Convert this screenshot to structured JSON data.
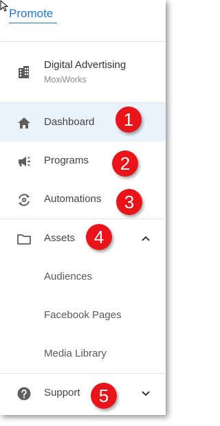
{
  "app": {
    "brand": "Promote"
  },
  "org": {
    "name": "Digital Advertising",
    "subtitle": "MoxiWorks"
  },
  "nav": {
    "dashboard": "Dashboard",
    "programs": "Programs",
    "automations": "Automations",
    "assets": "Assets",
    "support": "Support"
  },
  "assets_sub": [
    "Audiences",
    "Facebook Pages",
    "Media Library"
  ],
  "badges": [
    "1",
    "2",
    "3",
    "4",
    "5"
  ],
  "icons": {
    "org": "building-icon",
    "dashboard": "home-icon",
    "programs": "megaphone-icon",
    "automations": "automation-sync-icon",
    "assets": "folder-icon",
    "support": "help-circle-icon"
  },
  "colors": {
    "accent": "#1e78d2",
    "active_bg": "#eaf2fb",
    "badge": "#e8141a"
  }
}
